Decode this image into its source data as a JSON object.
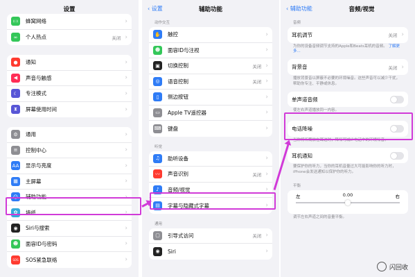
{
  "panel1": {
    "title": "设置",
    "group1": [
      {
        "label": "蜂窝网络",
        "value": "",
        "color": "#34c759",
        "icon": "antenna-icon"
      },
      {
        "label": "个人热点",
        "value": "关闭",
        "color": "#34c759",
        "icon": "link-icon"
      }
    ],
    "group2": [
      {
        "label": "通知",
        "value": "",
        "color": "#ff3b30",
        "icon": "bell-icon"
      },
      {
        "label": "声音与触感",
        "value": "",
        "color": "#ff2d55",
        "icon": "speaker-icon"
      },
      {
        "label": "专注模式",
        "value": "",
        "color": "#5856d6",
        "icon": "moon-icon"
      },
      {
        "label": "屏幕使用时间",
        "value": "",
        "color": "#5856d6",
        "icon": "hourglass-icon"
      }
    ],
    "group3": [
      {
        "label": "通用",
        "value": "",
        "color": "#8e8e93",
        "icon": "gear-icon"
      },
      {
        "label": "控制中心",
        "value": "",
        "color": "#8e8e93",
        "icon": "switches-icon"
      },
      {
        "label": "显示与亮度",
        "value": "",
        "color": "#2f7cf6",
        "icon": "aa-icon"
      },
      {
        "label": "主屏幕",
        "value": "",
        "color": "#2f7cf6",
        "icon": "grid-icon"
      },
      {
        "label": "辅助功能",
        "value": "",
        "color": "#2f7cf6",
        "icon": "accessibility-icon"
      },
      {
        "label": "墙纸",
        "value": "",
        "color": "#34aadc",
        "icon": "flower-icon"
      },
      {
        "label": "Siri与搜索",
        "value": "",
        "color": "#222222",
        "icon": "siri-icon"
      },
      {
        "label": "面容ID与密码",
        "value": "",
        "color": "#34c759",
        "icon": "faceid-icon"
      },
      {
        "label": "SOS紧急联络",
        "value": "",
        "color": "#ff3b30",
        "icon": "sos-icon"
      }
    ]
  },
  "panel2": {
    "back": "设置",
    "title": "辅助功能",
    "section1": "动作交互",
    "group1": [
      {
        "label": "触控",
        "value": "",
        "color": "#2f7cf6",
        "icon": "hand-icon"
      },
      {
        "label": "面容ID与注视",
        "value": "",
        "color": "#34c759",
        "icon": "faceid-icon"
      },
      {
        "label": "切换控制",
        "value": "关闭",
        "color": "#222222",
        "icon": "switch-icon"
      },
      {
        "label": "语音控制",
        "value": "关闭",
        "color": "#2f7cf6",
        "icon": "voice-icon"
      },
      {
        "label": "侧边按钮",
        "value": "",
        "color": "#2f7cf6",
        "icon": "side-button-icon"
      },
      {
        "label": "Apple TV遥控器",
        "value": "",
        "color": "#8e8e93",
        "icon": "remote-icon"
      },
      {
        "label": "键盘",
        "value": "",
        "color": "#8e8e93",
        "icon": "keyboard-icon"
      }
    ],
    "section2": "听觉",
    "group2": [
      {
        "label": "助听设备",
        "value": "",
        "color": "#2f7cf6",
        "icon": "ear-icon"
      },
      {
        "label": "声音识别",
        "value": "关闭",
        "color": "#ff3b30",
        "icon": "waveform-icon"
      },
      {
        "label": "音频/视觉",
        "value": "",
        "color": "#2f7cf6",
        "icon": "audio-visual-icon"
      },
      {
        "label": "字幕与隐藏式字幕",
        "value": "",
        "color": "#2f7cf6",
        "icon": "captions-icon"
      }
    ],
    "section3": "通用",
    "group3": [
      {
        "label": "引导式访问",
        "value": "关闭",
        "color": "#8e8e93",
        "icon": "lock-icon"
      },
      {
        "label": "Siri",
        "value": "",
        "color": "#222222",
        "icon": "siri-icon"
      }
    ]
  },
  "panel3": {
    "back": "辅助功能",
    "title": "音频/视觉",
    "section1": "音频",
    "headphone_label": "耳机调节",
    "headphone_value": "关闭",
    "headphone_desc": "为你的设备音频调节支持的Apple和Beats耳机的音频。",
    "headphone_link": "了解更多...",
    "bg_label": "背景音",
    "bg_value": "关闭",
    "bg_desc": "播放背景音以屏蔽不必要的环境噪音。这些声音可以减少干扰，帮助你专注、平静或休息。",
    "mono_label": "单声道音频",
    "mono_desc": "使左右声道播放同一内容。",
    "phone_label": "电话降噪",
    "phone_desc": "当你将听筒放在耳边时，降噪可减少电话中的环境噪音。",
    "earphone_label": "耳机通知",
    "earphone_desc": "要保护你的听力，当你的耳机音量过大可能影响你的听力时，iPhone会发送通知以保护你的听力。",
    "balance_section": "平衡",
    "balance_left": "左",
    "balance_value": "0.00",
    "balance_right": "右",
    "balance_fraction": 0.5,
    "balance_desc": "调节左右声道之间的音量平衡。"
  },
  "watermark": "闪回收",
  "colors": {
    "highlight": "#d13ad8",
    "accent": "#2f7cf6"
  }
}
